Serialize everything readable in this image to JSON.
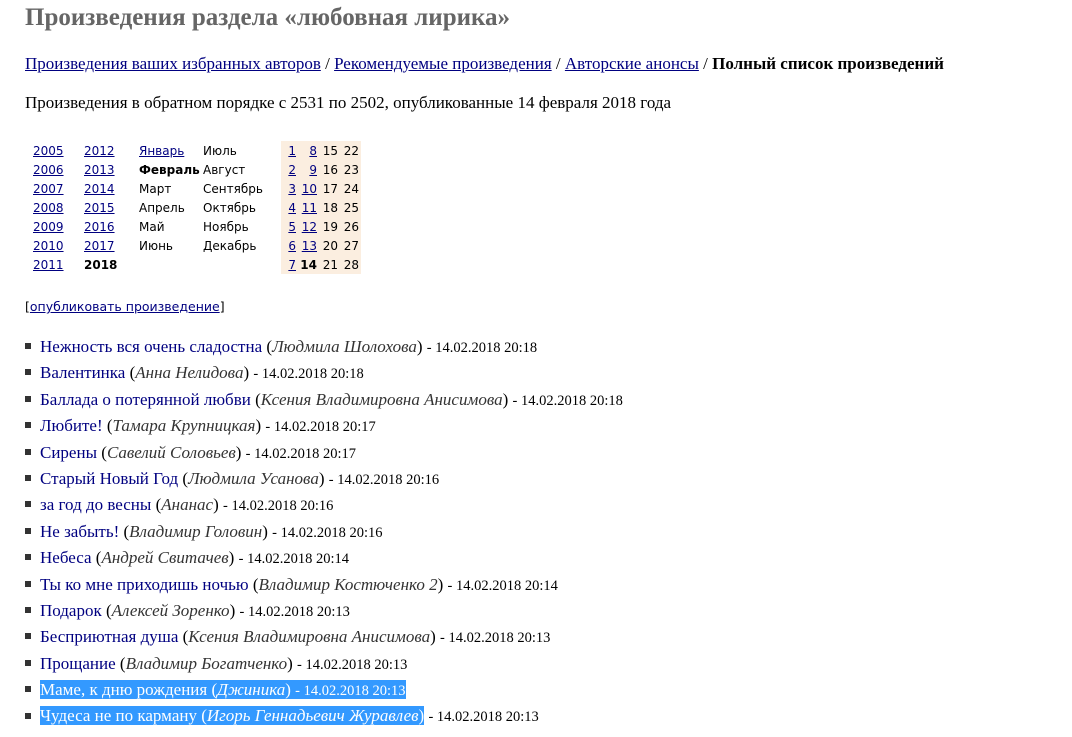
{
  "page_title": "Произведения раздела «любовная лирика»",
  "nav": {
    "links": [
      "Произведения ваших избранных авторов",
      "Рекомендуемые произведения",
      "Авторские анонсы"
    ],
    "separator": "/",
    "current": "Полный список произведений"
  },
  "intro": "Произведения в обратном порядке с 2531 по 2502, опубликованные 14 февраля 2018 года",
  "calendar": {
    "rows": [
      {
        "y1": "2005",
        "y2": "2012",
        "m1": "Январь",
        "m2": "Июль",
        "d": [
          "1",
          "8",
          "15",
          "22"
        ]
      },
      {
        "y1": "2006",
        "y2": "2013",
        "m1": "Февраль",
        "m2": "Август",
        "d": [
          "2",
          "9",
          "16",
          "23"
        ]
      },
      {
        "y1": "2007",
        "y2": "2014",
        "m1": "Март",
        "m2": "Сентябрь",
        "d": [
          "3",
          "10",
          "17",
          "24"
        ]
      },
      {
        "y1": "2008",
        "y2": "2015",
        "m1": "Апрель",
        "m2": "Октябрь",
        "d": [
          "4",
          "11",
          "18",
          "25"
        ]
      },
      {
        "y1": "2009",
        "y2": "2016",
        "m1": "Май",
        "m2": "Ноябрь",
        "d": [
          "5",
          "12",
          "19",
          "26"
        ]
      },
      {
        "y1": "2010",
        "y2": "2017",
        "m1": "Июнь",
        "m2": "Декабрь",
        "d": [
          "6",
          "13",
          "20",
          "27"
        ]
      },
      {
        "y1": "2011",
        "y2": "2018",
        "m1": "",
        "m2": "",
        "d": [
          "7",
          "14",
          "21",
          "28"
        ]
      }
    ]
  },
  "publish_label": "опубликовать произведение",
  "works": [
    {
      "title": "Нежность вся очень сладостна",
      "author": "Людмила Шолохова",
      "date": "14.02.2018 20:18"
    },
    {
      "title": "Валентинка",
      "author": "Анна Нелидова",
      "date": "14.02.2018 20:18"
    },
    {
      "title": "Баллада о потерянной любви",
      "author": "Ксения Владимировна Анисимова",
      "date": "14.02.2018 20:18"
    },
    {
      "title": "Любите!",
      "author": "Тамара Крупницкая",
      "date": "14.02.2018 20:17"
    },
    {
      "title": "Сирены",
      "author": "Савелий Соловьев",
      "date": "14.02.2018 20:17"
    },
    {
      "title": "Старый Новый Год",
      "author": "Людмила Усанова",
      "date": "14.02.2018 20:16"
    },
    {
      "title": "за год до весны",
      "author": "Ананас",
      "date": "14.02.2018 20:16"
    },
    {
      "title": "Не забыть!",
      "author": "Владимир Головин",
      "date": "14.02.2018 20:16"
    },
    {
      "title": "Небеса",
      "author": "Андрей Свитачев",
      "date": "14.02.2018 20:14"
    },
    {
      "title": "Ты ко мне приходишь ночью",
      "author": "Владимир Костюченко 2",
      "date": "14.02.2018 20:14"
    },
    {
      "title": "Подарок",
      "author": "Алексей Зоренко",
      "date": "14.02.2018 20:13"
    },
    {
      "title": "Бесприютная душа",
      "author": "Ксения Владимировна Анисимова",
      "date": "14.02.2018 20:13"
    },
    {
      "title": "Прощание",
      "author": "Владимир Богатченко",
      "date": "14.02.2018 20:13"
    },
    {
      "title": "Маме, к дню рождения",
      "author": "Джиника",
      "date": "14.02.2018 20:13"
    },
    {
      "title": "Чудеса не по карману",
      "author": "Игорь Геннадьевич Журавлев",
      "date": "14.02.2018 20:13"
    }
  ],
  "colors": {
    "link": "#000080",
    "heading": "#666666",
    "highlight": "#3399ff",
    "calendar_days_bg": "#fbeee0"
  }
}
